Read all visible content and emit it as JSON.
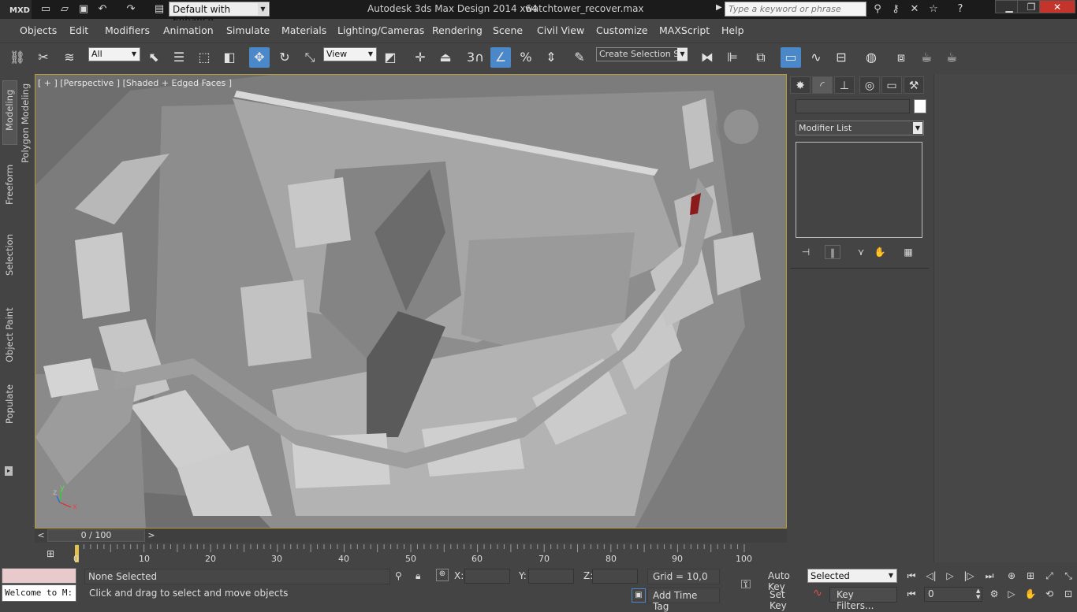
{
  "titlebar": {
    "logo": "MXD",
    "workspace": "Default with Enhance",
    "app_title": "Autodesk 3ds Max Design 2014 x64",
    "file_title": "watchtower_recover.max",
    "search_placeholder": "Type a keyword or phrase"
  },
  "menu": [
    "Objects",
    "Edit",
    "Modifiers",
    "Animation",
    "Simulate",
    "Materials",
    "Lighting/Cameras",
    "Rendering",
    "Scene",
    "Civil View",
    "Customize",
    "MAXScript",
    "Help"
  ],
  "toolbar": {
    "selection_filter": "All",
    "ref_coord": "View",
    "snap_label": "3",
    "create_selection_set": "Create Selection Se"
  },
  "ribbon_tabs": [
    "Modeling",
    "Polygon Modeling",
    "Freeform",
    "Selection",
    "Object Paint",
    "Populate"
  ],
  "viewport": {
    "label": "[ + ] [Perspective ] [Shaded + Edged Faces ]",
    "axis_x": "x",
    "axis_y": "y",
    "axis_z": "z"
  },
  "command_panel": {
    "modifier_list": "Modifier List"
  },
  "timeline": {
    "slider_text": "0 / 100",
    "ticks": [
      "0",
      "10",
      "20",
      "30",
      "40",
      "50",
      "60",
      "70",
      "80",
      "90",
      "100"
    ]
  },
  "status": {
    "listener_text": "Welcome to M:",
    "selection": "None Selected",
    "prompt": "Click and drag to select and move objects",
    "x_label": "X:",
    "y_label": "Y:",
    "z_label": "Z:",
    "grid": "Grid = 10,0",
    "add_time_tag": "Add Time Tag",
    "auto_key": "Auto Key",
    "set_key": "Set Key",
    "key_mode": "Selected",
    "key_filters": "Key Filters...",
    "current_frame": "0"
  },
  "colors": {
    "active_tool": "#4a88c9",
    "viewport_border": "#b59a3a",
    "close_button": "#c4342b"
  }
}
